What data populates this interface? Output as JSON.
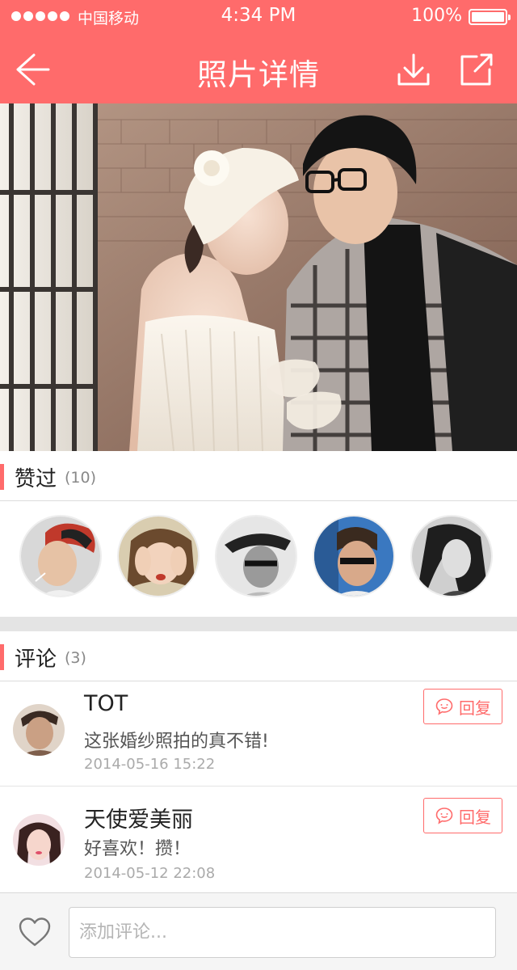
{
  "status_bar": {
    "carrier": "中国移动",
    "time": "4:34 PM",
    "battery": "100%"
  },
  "nav": {
    "title": "照片详情",
    "back_icon": "arrow-left-icon",
    "download_icon": "download-icon",
    "share_icon": "share-icon"
  },
  "likes": {
    "title": "赞过",
    "count": "(10)",
    "avatars": [
      "avatar-1",
      "avatar-2",
      "avatar-3",
      "avatar-4",
      "avatar-5"
    ]
  },
  "comments_section": {
    "title": "评论",
    "count": "(3)",
    "reply_label": "回复",
    "items": [
      {
        "name": "TOT",
        "text": "这张婚纱照拍的真不错!",
        "time": "2014-05-16   15:22"
      },
      {
        "name": "天使爱美丽",
        "text": "好喜欢！攒！",
        "time": "2014-05-12   22:08"
      }
    ]
  },
  "bottom_bar": {
    "placeholder": "添加评论..."
  },
  "colors": {
    "accent": "#ff6b6b",
    "divider": "#dcdcdc",
    "muted_text": "#aaaaaa"
  }
}
